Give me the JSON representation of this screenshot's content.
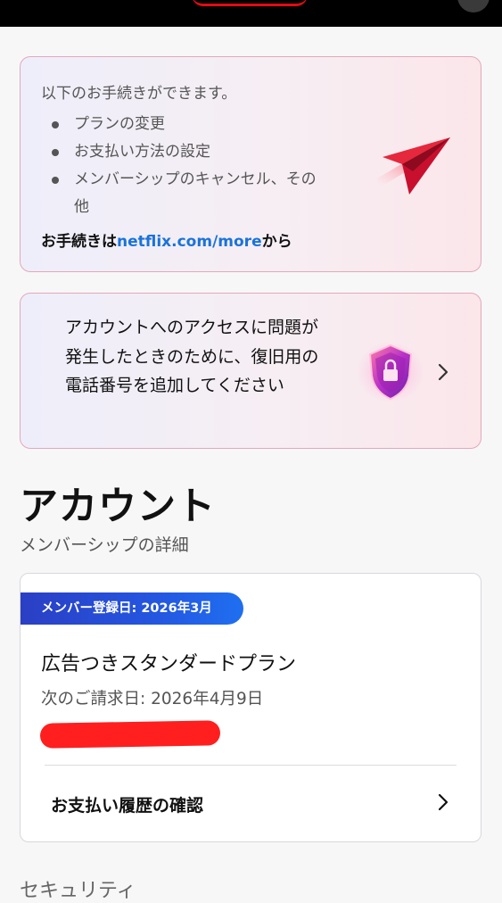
{
  "card_actions": {
    "intro": "以下のお手続きができます。",
    "items": [
      "プランの変更",
      "お支払い方法の設定",
      "メンバーシップのキャンセル、その他"
    ],
    "footer_prefix": "お手続きは",
    "footer_link": "netflix.com/more",
    "footer_suffix": "から",
    "icon": "paper-plane-icon"
  },
  "card_recovery": {
    "text": "アカウントへのアクセスに問題が発生したときのために、復旧用の電話番号を追加してください",
    "icon": "lock-shield-icon"
  },
  "account": {
    "title": "アカウント",
    "subtitle": "メンバーシップの詳細"
  },
  "membership": {
    "badge": "メンバー登録日: 2026年3月",
    "plan": "広告つきスタンダードプラン",
    "billing": "次のご請求日: 2026年4月9日",
    "history": "お支払い履歴の確認"
  },
  "next_section": "セキュリティ",
  "colors": {
    "link": "#1a73d9",
    "badge": "#2456e0",
    "accent_red": "#e50914"
  }
}
